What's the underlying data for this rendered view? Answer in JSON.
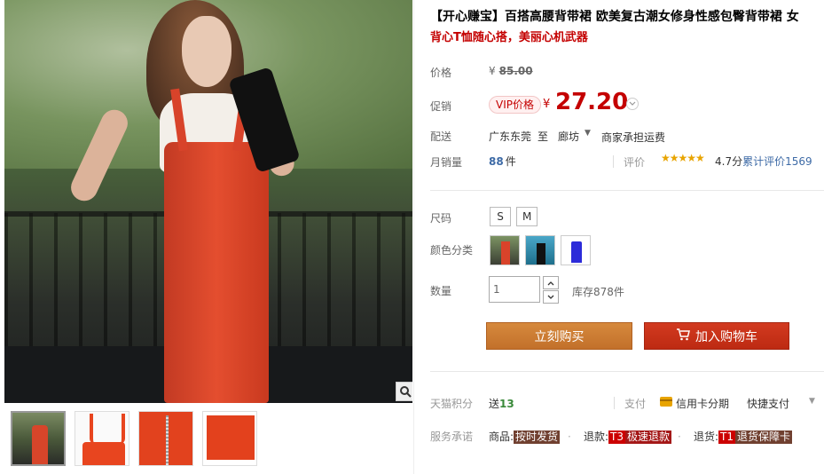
{
  "product": {
    "title": "【开心赚宝】百搭高腰背带裙 欧美复古潮女修身性感包臀背带裙 女",
    "subtitle": "背心T恤随心搭，美丽心机武器"
  },
  "price": {
    "label": "价格",
    "currency": "¥",
    "original": "85.00"
  },
  "promo": {
    "label": "促销",
    "badge": "VIP价格",
    "currency": "¥",
    "price": "27.20"
  },
  "shipping": {
    "label": "配送",
    "from": "广东东莞",
    "to_word": "至",
    "destination": "廊坊",
    "fee": "商家承担运费"
  },
  "sales": {
    "label": "月销量",
    "count": "88",
    "unit": "件",
    "review_label": "评价",
    "stars": "★★★★★",
    "score": "4.7分",
    "review_text": "累计评价",
    "review_count": "1569"
  },
  "options": {
    "size_label": "尺码",
    "sizes": [
      "S",
      "M"
    ],
    "color_label": "颜色分类",
    "quantity_label": "数量",
    "quantity_value": "1",
    "stock": "库存878件"
  },
  "actions": {
    "buy_now": "立刻购买",
    "add_cart": "加入购物车"
  },
  "points": {
    "label": "天猫积分",
    "prefix": "送",
    "value": "13"
  },
  "payment": {
    "label": "支付",
    "card": "信用卡分期",
    "quick": "快捷支付"
  },
  "promise": {
    "label": "服务承诺",
    "goods_prefix": "商品:",
    "goods_tag": "按时发货",
    "refund_prefix": "退款:",
    "refund_code": "T3",
    "refund_tag": "极速退款",
    "return_prefix": "退货:",
    "return_code": "T1",
    "return_tag": "退货保障卡"
  },
  "colors": {
    "accent_red": "#c40000",
    "buy_now_bg": "#c97a32",
    "add_cart_bg": "#c8321a",
    "link_blue": "#3d6aa6",
    "star_gold": "#e8a400"
  },
  "icons": {
    "zoom": "magnifier-icon",
    "cart": "cart-icon",
    "card": "credit-card-icon"
  }
}
